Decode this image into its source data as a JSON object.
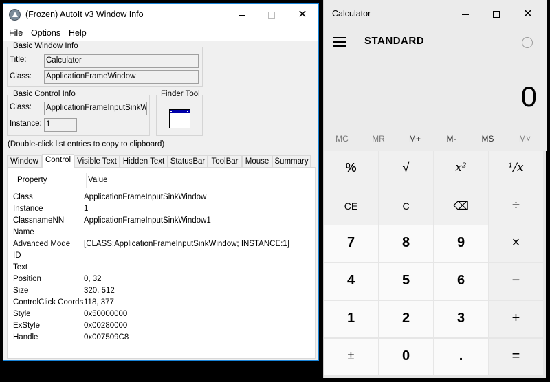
{
  "autoit": {
    "title": "(Frozen) AutoIt v3 Window Info",
    "menu": [
      "File",
      "Options",
      "Help"
    ],
    "basic_window_info": {
      "legend": "Basic Window Info",
      "title_label": "Title:",
      "title_value": "Calculator",
      "class_label": "Class:",
      "class_value": "ApplicationFrameWindow"
    },
    "basic_control_info": {
      "legend": "Basic Control Info",
      "class_label": "Class:",
      "class_value": "ApplicationFrameInputSinkWin",
      "instance_label": "Instance:",
      "instance_value": "1"
    },
    "finder_tool": {
      "legend": "Finder Tool"
    },
    "hint": "(Double-click list entries to copy to clipboard)",
    "tabs": [
      "Window",
      "Control",
      "Visible Text",
      "Hidden Text",
      "StatusBar",
      "ToolBar",
      "Mouse",
      "Summary"
    ],
    "active_tab": "Control",
    "list_headers": {
      "property": "Property",
      "value": "Value"
    },
    "rows": [
      {
        "k": "Class",
        "v": "ApplicationFrameInputSinkWindow"
      },
      {
        "k": "Instance",
        "v": "1"
      },
      {
        "k": "ClassnameNN",
        "v": "ApplicationFrameInputSinkWindow1"
      },
      {
        "k": "Name",
        "v": ""
      },
      {
        "k": "Advanced Mode",
        "v": "[CLASS:ApplicationFrameInputSinkWindow; INSTANCE:1]"
      },
      {
        "k": "ID",
        "v": ""
      },
      {
        "k": "Text",
        "v": ""
      },
      {
        "k": "Position",
        "v": "0, 32"
      },
      {
        "k": "Size",
        "v": "320, 512"
      },
      {
        "k": "ControlClick Coords",
        "v": "118, 377"
      },
      {
        "k": "Style",
        "v": "0x50000000"
      },
      {
        "k": "ExStyle",
        "v": "0x00280000"
      },
      {
        "k": "Handle",
        "v": "0x007509C8"
      }
    ]
  },
  "calculator": {
    "title": "Calculator",
    "mode": "STANDARD",
    "display": "0",
    "memory": [
      "MC",
      "MR",
      "M+",
      "M-",
      "MS",
      "M˅"
    ],
    "keys": [
      [
        "%",
        "√",
        "x²",
        "¹/x"
      ],
      [
        "CE",
        "C",
        "⌫",
        "÷"
      ],
      [
        "7",
        "8",
        "9",
        "×"
      ],
      [
        "4",
        "5",
        "6",
        "−"
      ],
      [
        "1",
        "2",
        "3",
        "+"
      ],
      [
        "±",
        "0",
        ".",
        "="
      ]
    ]
  },
  "window_controls": {
    "minimize": "",
    "maximize": "",
    "close": "✕"
  }
}
